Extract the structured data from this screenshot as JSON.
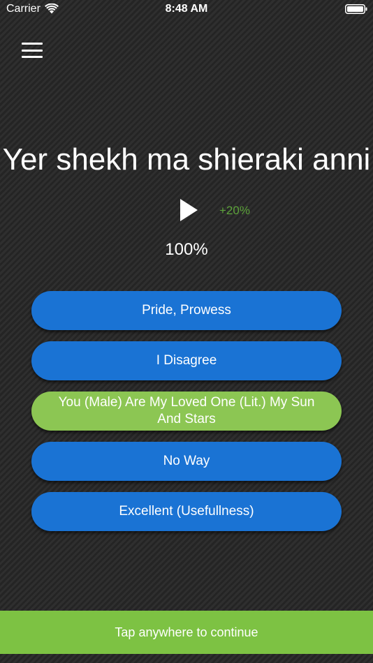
{
  "status_bar": {
    "carrier": "Carrier",
    "time": "8:48 AM",
    "wifi_icon": "wifi-icon",
    "battery_icon": "battery-icon"
  },
  "menu": {
    "icon": "hamburger-menu-icon"
  },
  "phrase": "Yer shekh ma shieraki anni",
  "audio": {
    "play_icon": "play-icon",
    "speed": "+20%",
    "progress": "100%"
  },
  "options": [
    {
      "label": "Pride, Prowess",
      "state": "default"
    },
    {
      "label": "I Disagree",
      "state": "default"
    },
    {
      "label": "You (Male) Are My Loved One (Lit.) My Sun And Stars",
      "state": "correct"
    },
    {
      "label": "No Way",
      "state": "default"
    },
    {
      "label": "Excellent (Usefullness)",
      "state": "default"
    }
  ],
  "continue_label": "Tap anywhere to continue",
  "colors": {
    "option_default": "#1a73d4",
    "option_correct": "#8cc653",
    "continue_bar": "#7dc243",
    "speed_text": "#5da33b",
    "background": "#2b2b2b"
  }
}
